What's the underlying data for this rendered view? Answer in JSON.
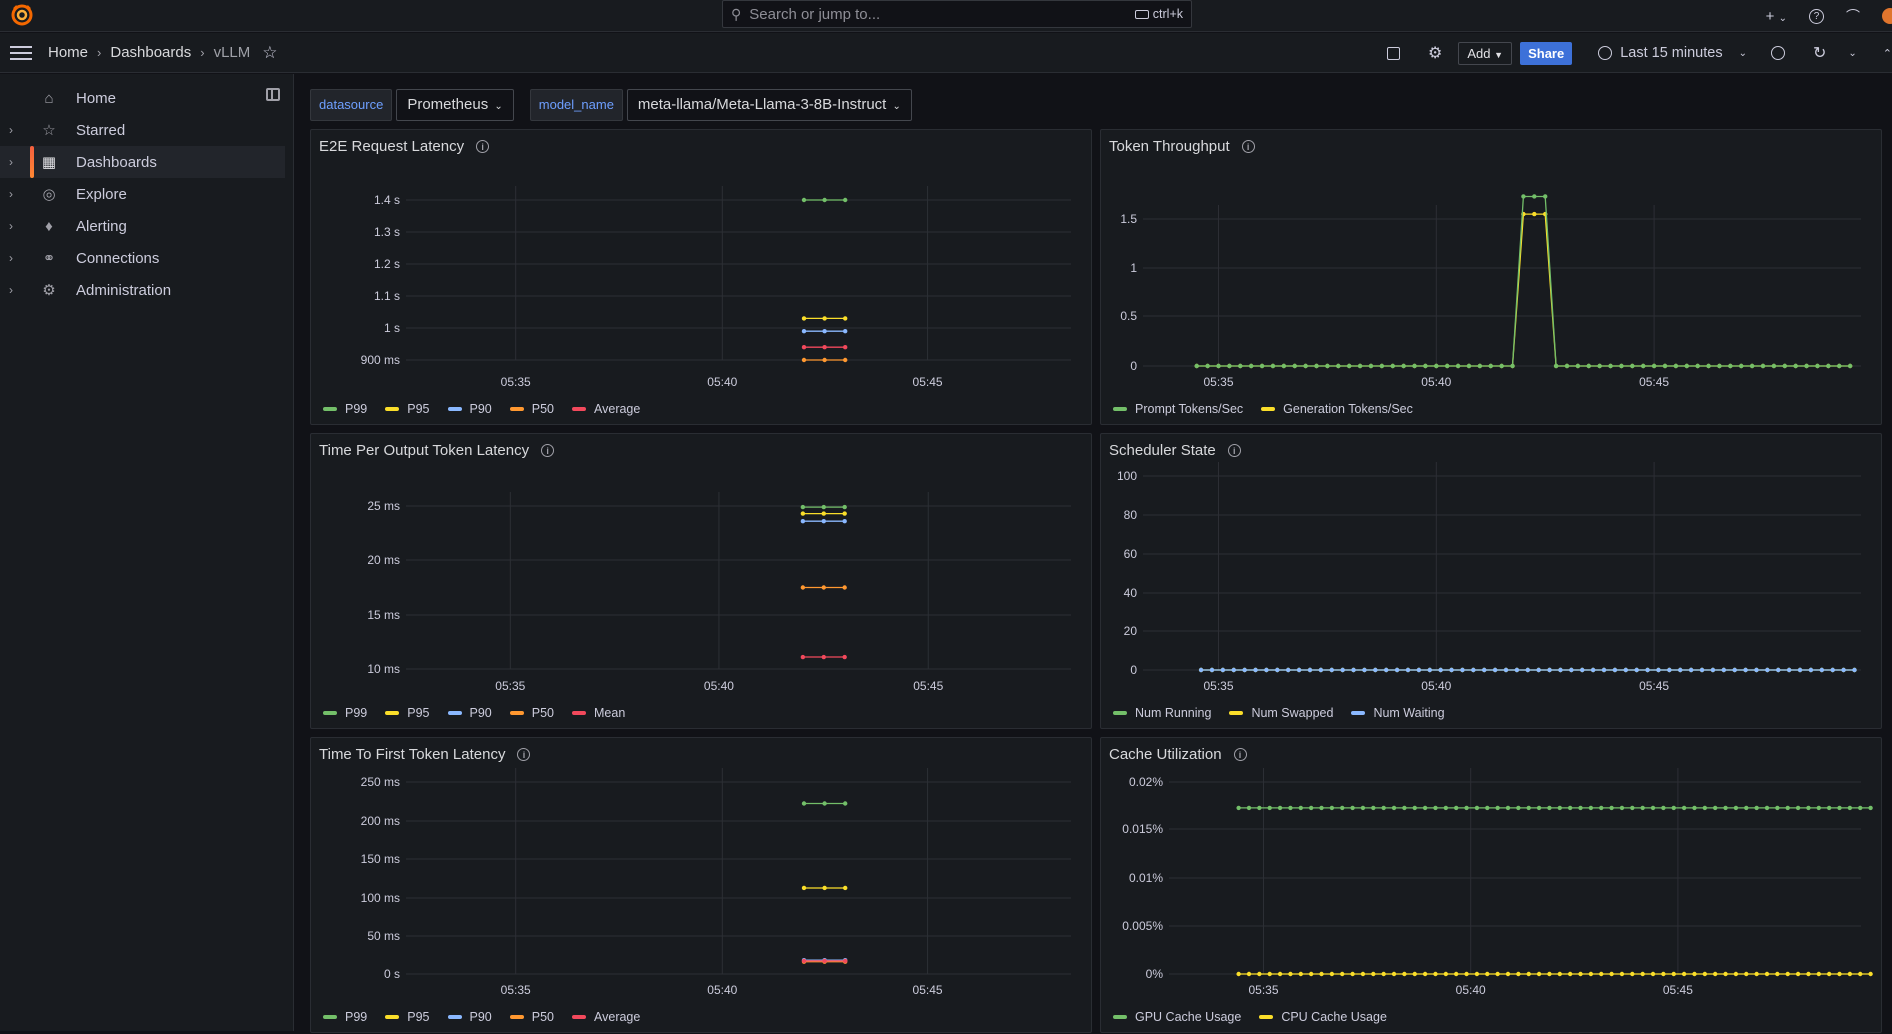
{
  "search": {
    "placeholder": "Search or jump to...",
    "shortcut": "ctrl+k"
  },
  "breadcrumb": [
    "Home",
    "Dashboards",
    "vLLM"
  ],
  "toolbar": {
    "add_label": "Add",
    "share_label": "Share",
    "time_range": "Last 15 minutes"
  },
  "sidebar": {
    "items": [
      {
        "label": "Home",
        "icon": "home-icon",
        "expandable": false,
        "active": false
      },
      {
        "label": "Starred",
        "icon": "star-icon",
        "expandable": true,
        "active": false
      },
      {
        "label": "Dashboards",
        "icon": "grid-icon",
        "expandable": true,
        "active": true
      },
      {
        "label": "Explore",
        "icon": "compass-icon",
        "expandable": true,
        "active": false
      },
      {
        "label": "Alerting",
        "icon": "bell-icon",
        "expandable": true,
        "active": false
      },
      {
        "label": "Connections",
        "icon": "plug-icon",
        "expandable": true,
        "active": false
      },
      {
        "label": "Administration",
        "icon": "gear-icon",
        "expandable": true,
        "active": false
      }
    ]
  },
  "variables": [
    {
      "label": "datasource",
      "value": "Prometheus"
    },
    {
      "label": "model_name",
      "value": "meta-llama/Meta-Llama-3-8B-Instruct"
    }
  ],
  "colors": {
    "green": "#73bf69",
    "yellow": "#fade2a",
    "blue": "#8ab8ff",
    "orange": "#ff9830",
    "red": "#f2495c",
    "accent": "#3d71d9"
  },
  "chart_data": [
    {
      "type": "line",
      "title": "E2E Request Latency",
      "x_ticks": [
        "05:35",
        "05:40",
        "05:45"
      ],
      "y_ticks": [
        "900 ms",
        "1 s",
        "1.1 s",
        "1.2 s",
        "1.3 s",
        "1.4 s"
      ],
      "ylim": [
        0.9,
        1.4
      ],
      "series": [
        {
          "name": "P99",
          "color": "green",
          "x": [
            "05:42:00",
            "05:42:30",
            "05:43:00"
          ],
          "values": [
            1.4,
            1.4,
            1.4
          ]
        },
        {
          "name": "P95",
          "color": "yellow",
          "x": [
            "05:42:00",
            "05:42:30",
            "05:43:00"
          ],
          "values": [
            1.03,
            1.03,
            1.03
          ]
        },
        {
          "name": "P90",
          "color": "blue",
          "x": [
            "05:42:00",
            "05:42:30",
            "05:43:00"
          ],
          "values": [
            0.99,
            0.99,
            0.99
          ]
        },
        {
          "name": "P50",
          "color": "orange",
          "x": [
            "05:42:00",
            "05:42:30",
            "05:43:00"
          ],
          "values": [
            0.9,
            0.9,
            0.9
          ]
        },
        {
          "name": "Average",
          "color": "red",
          "x": [
            "05:42:00",
            "05:42:30",
            "05:43:00"
          ],
          "values": [
            0.94,
            0.94,
            0.94
          ]
        }
      ]
    },
    {
      "type": "line",
      "title": "Token Throughput",
      "x_ticks": [
        "05:35",
        "05:40",
        "05:45"
      ],
      "y_ticks": [
        "0",
        "0.5",
        "1",
        "1.5"
      ],
      "ylim": [
        0,
        1.5
      ],
      "series": [
        {
          "name": "Prompt Tokens/Sec",
          "color": "green",
          "description": "0 except 1.73 during spike ~05:42-05:43"
        },
        {
          "name": "Generation Tokens/Sec",
          "color": "yellow",
          "description": "0 except 1.55 during spike ~05:42-05:43"
        }
      ]
    },
    {
      "type": "line",
      "title": "Time Per Output Token Latency",
      "x_ticks": [
        "05:35",
        "05:40",
        "05:45"
      ],
      "y_ticks": [
        "10 ms",
        "15 ms",
        "20 ms",
        "25 ms"
      ],
      "ylim": [
        10,
        25
      ],
      "series": [
        {
          "name": "P99",
          "color": "green",
          "values": [
            24.9,
            24.9,
            24.9
          ]
        },
        {
          "name": "P95",
          "color": "yellow",
          "values": [
            24.3,
            24.3,
            24.3
          ]
        },
        {
          "name": "P90",
          "color": "blue",
          "values": [
            23.6,
            23.6,
            23.6
          ]
        },
        {
          "name": "P50",
          "color": "orange",
          "values": [
            17.5,
            17.5,
            17.5
          ]
        },
        {
          "name": "Mean",
          "color": "red",
          "values": [
            11.1,
            11.1,
            11.1
          ]
        }
      ]
    },
    {
      "type": "line",
      "title": "Scheduler State",
      "x_ticks": [
        "05:35",
        "05:40",
        "05:45"
      ],
      "y_ticks": [
        "0",
        "20",
        "40",
        "60",
        "80",
        "100"
      ],
      "ylim": [
        0,
        100
      ],
      "series": [
        {
          "name": "Num Running",
          "color": "green",
          "values": "all 0"
        },
        {
          "name": "Num Swapped",
          "color": "yellow",
          "values": "all 0"
        },
        {
          "name": "Num Waiting",
          "color": "blue",
          "values": "all 0"
        }
      ]
    },
    {
      "type": "line",
      "title": "Time To First Token Latency",
      "x_ticks": [
        "05:35",
        "05:40",
        "05:45"
      ],
      "y_ticks": [
        "0 s",
        "50 ms",
        "100 ms",
        "150 ms",
        "200 ms",
        "250 ms"
      ],
      "ylim": [
        0,
        250
      ],
      "series": [
        {
          "name": "P99",
          "color": "green",
          "values": [
            222,
            222,
            222
          ]
        },
        {
          "name": "P95",
          "color": "yellow",
          "values": [
            112,
            112,
            112
          ]
        },
        {
          "name": "P90",
          "color": "blue",
          "values": [
            18,
            18,
            18
          ]
        },
        {
          "name": "P50",
          "color": "orange",
          "values": [
            16,
            16,
            16
          ]
        },
        {
          "name": "Average",
          "color": "red",
          "values": [
            17,
            17,
            17
          ]
        }
      ]
    },
    {
      "type": "line",
      "title": "Cache Utilization",
      "x_ticks": [
        "05:35",
        "05:40",
        "05:45"
      ],
      "y_ticks": [
        "0%",
        "0.005%",
        "0.01%",
        "0.015%",
        "0.02%"
      ],
      "ylim": [
        0,
        0.02
      ],
      "series": [
        {
          "name": "GPU Cache Usage",
          "color": "green",
          "values": "constant 0.0173%"
        },
        {
          "name": "CPU Cache Usage",
          "color": "yellow",
          "values": "constant 0%"
        }
      ]
    }
  ]
}
